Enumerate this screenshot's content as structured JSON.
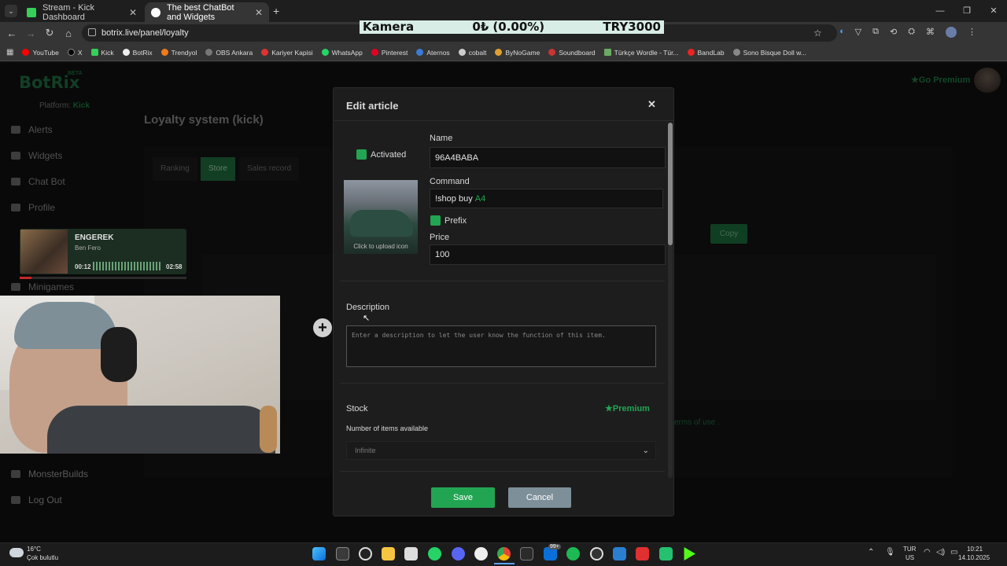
{
  "browser": {
    "tabs": [
      {
        "title": "Stream - Kick Dashboard"
      },
      {
        "title": "The best ChatBot and Widgets"
      }
    ],
    "url": "botrix.live/panel/loyalty",
    "bookmarks": [
      "YouTube",
      "X",
      "Kick",
      "BotRix",
      "Trendyol",
      "OBS Ankara",
      "Kariyer Kapisi",
      "WhatsApp",
      "Pinterest",
      "Aternos",
      "cobalt",
      "ByNoGame",
      "Soundboard",
      "Türkçe Wordle - Tür...",
      "BandLab",
      "Sono Bisque Doll w..."
    ]
  },
  "ticker": {
    "name": "Kamera",
    "value": "0₺ (0.00%)",
    "goal": "TRY3000"
  },
  "app": {
    "logo": "BotRix",
    "beta": "BETA",
    "platform_label": "Platform:",
    "platform_value": "Kick",
    "go_premium": "Go Premium",
    "sidebar": [
      "Alerts",
      "Widgets",
      "Chat Bot",
      "Profile",
      "Minigames",
      "MonsterBuilds",
      "Log Out"
    ],
    "page_title": "Loyalty system (kick)",
    "tabs": [
      "Ranking",
      "Store",
      "Sales record"
    ],
    "copy_button": "Copy",
    "bg_link": "erms of use ."
  },
  "music": {
    "title": "ENGEREK",
    "artist": "Ben Fero",
    "elapsed": "00:12",
    "total": "02:58",
    "progress": 0.07
  },
  "modal": {
    "title": "Edit article",
    "activated_label": "Activated",
    "upload_hint": "Click to upload icon",
    "name_label": "Name",
    "name_value": "96A4BABA",
    "command_label": "Command",
    "command_prefix": "!shop buy",
    "command_value": "A4",
    "prefix_label": "Prefix",
    "price_label": "Price",
    "price_value": "100",
    "description_label": "Description",
    "description_placeholder": "Enter a description to let the user know the function of this item.",
    "stock_label": "Stock",
    "premium_label": "Premium",
    "stock_sub": "Number of items available",
    "stock_select": "Infinite",
    "save": "Save",
    "cancel": "Cancel"
  },
  "taskbar": {
    "weather_temp": "16°C",
    "weather_text": "Çok bulutlu",
    "lang": "TUR",
    "region": "US",
    "time": "10:21",
    "date": "14.10.2025",
    "badge": "99+"
  },
  "colors": {
    "accent": "#22a552",
    "dark_bg": "#101010",
    "modal_bg": "#1d1d1d"
  }
}
